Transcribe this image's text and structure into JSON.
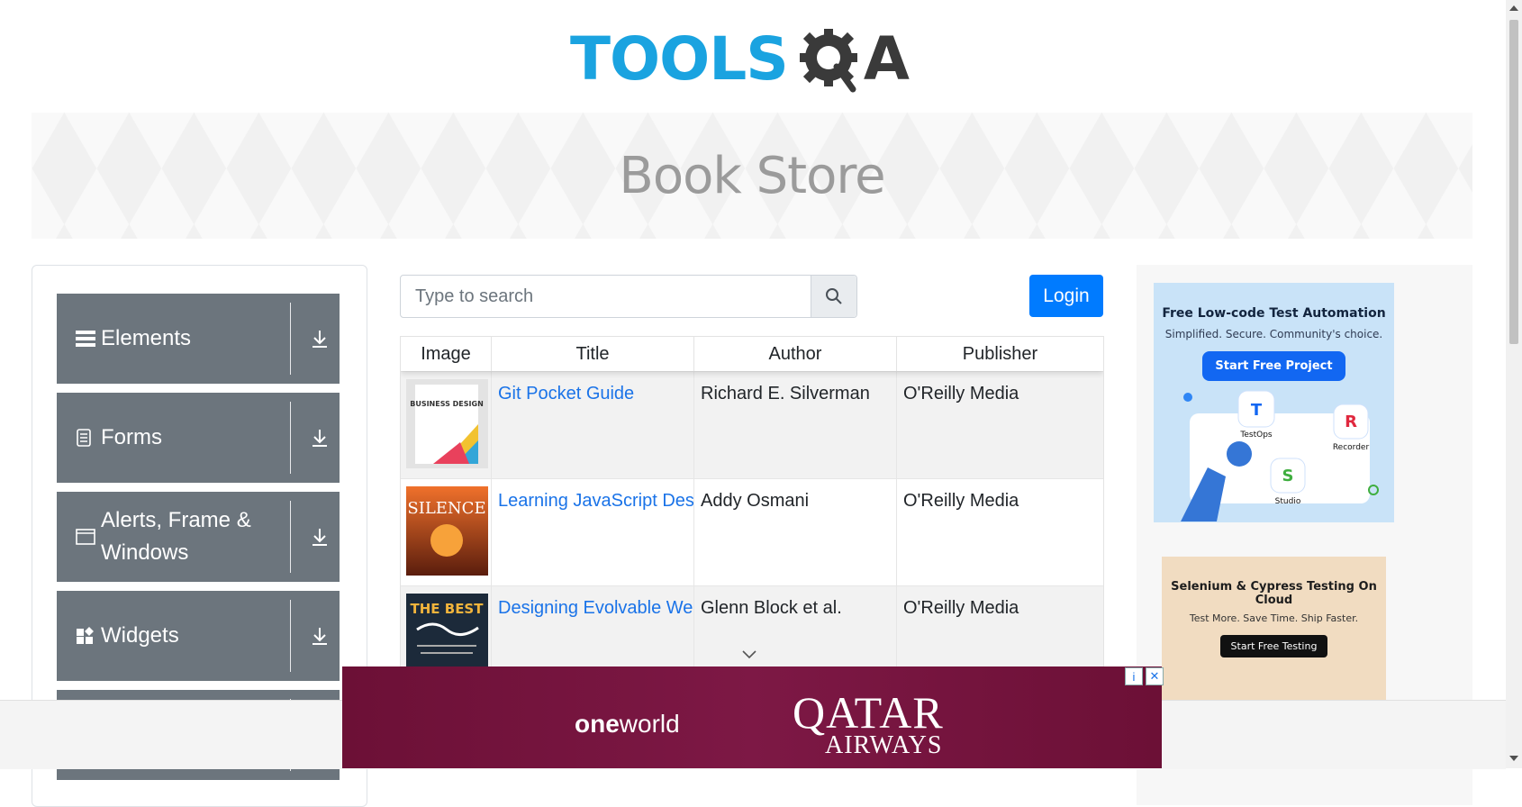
{
  "header": {
    "logo_part1": "TOOLS",
    "logo_part2": "A"
  },
  "banner": {
    "title": "Book Store"
  },
  "sidebar": {
    "groups": [
      {
        "label": "Elements",
        "icon": "hamburger-icon"
      },
      {
        "label": "Forms",
        "icon": "document-icon"
      },
      {
        "label": "Alerts, Frame & Windows",
        "icon": "window-icon"
      },
      {
        "label": "Widgets",
        "icon": "widgets-icon"
      }
    ]
  },
  "search": {
    "placeholder": "Type to search",
    "value": ""
  },
  "login": {
    "label": "Login"
  },
  "table": {
    "columns": [
      "Image",
      "Title",
      "Author",
      "Publisher"
    ],
    "rows": [
      {
        "title": "Git Pocket Guide",
        "author": "Richard E. Silverman",
        "publisher": "O'Reilly Media",
        "cover_text": "BUSINESS DESIGN"
      },
      {
        "title": "Learning JavaScript Design Patterns",
        "author": "Addy Osmani",
        "publisher": "O'Reilly Media",
        "cover_text": "SILENCE"
      },
      {
        "title": "Designing Evolvable Web APIs with ASP.NET",
        "author": "Glenn Block et al.",
        "publisher": "O'Reilly Media",
        "cover_text": "THE BEST"
      }
    ]
  },
  "ads": {
    "right1": {
      "title": "Free Low-code Test Automation",
      "subtitle": "Simplified. Secure. Community's choice.",
      "cta": "Start Free Project",
      "labels": [
        "TestOps",
        "Recorder",
        "Studio"
      ]
    },
    "right2": {
      "title": "Selenium & Cypress Testing On Cloud",
      "subtitle": "Test More. Save Time. Ship Faster.",
      "cta": "Start Free Testing"
    },
    "bottom": {
      "brand1_bold": "one",
      "brand1_rest": "world",
      "brand2_line1": "QATAR",
      "brand2_line2": "AIRWAYS"
    }
  },
  "colors": {
    "brand_blue": "#1aa3e0",
    "sidebar_gray": "#6c757d",
    "login_blue": "#007bff",
    "ad_maroon": "#6c1036"
  }
}
